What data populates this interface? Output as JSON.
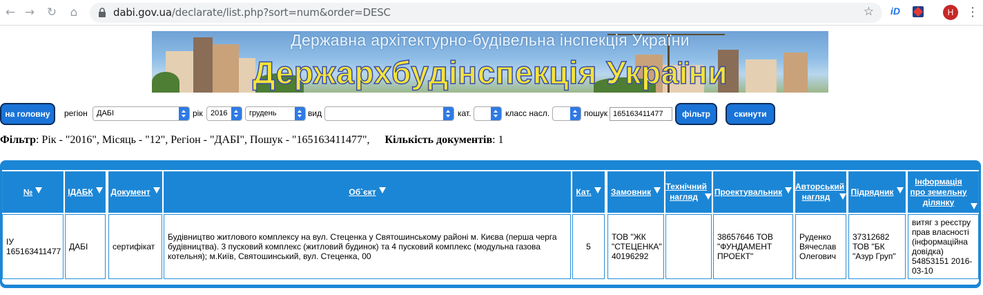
{
  "browser": {
    "url_host": "dabi.gov.ua",
    "url_path": "/declarate/list.php?sort=num&order=DESC",
    "ext_id_label": "iD",
    "avatar_letter": "Н"
  },
  "banner": {
    "top_text": "Державна архітектурно-будівельна інспекція України",
    "main_text": "Держархбудінспекція України"
  },
  "filter_bar": {
    "home_button": "на головну",
    "region_label": "регіон",
    "region_value": "ДАБІ",
    "year_label": "рік",
    "year_value": "2016",
    "month_value": "грудень",
    "type_label": "вид",
    "type_value": "",
    "cat_label": "кат.",
    "cat_value": "",
    "class_label": "класс насл.",
    "class_value": "",
    "search_label": "пошук",
    "search_value": "165163411477",
    "filter_button": "фільтр",
    "reset_button": "скинути"
  },
  "summary": {
    "filter_label": "Фільтр",
    "filter_text": ": Рік - \"2016\", Місяць - \"12\", Регіон - \"ДАБІ\", Пошук - \"165163411477\",",
    "count_label": "Кількість документів",
    "count_text": ": 1"
  },
  "table": {
    "headers": [
      "№",
      "ІДАБК",
      "Документ",
      "Об`єкт",
      "Кат.",
      "Замовник",
      "Технічний нагляд",
      "Проектувальник",
      "Авторський нагляд",
      "Підрядник",
      "Інформація про земельну ділянку"
    ],
    "rows": [
      {
        "num": "ІУ 165163411477",
        "idabk": "ДАБІ",
        "document": "сертифікат",
        "object": "Будівництво житлового комплексу на вул. Стеценка у Святошинському районі м. Києва (перша черга будівництва). 3 пусковий комплекс (житловий будинок) та 4 пусковий комплекс (модульна газова котельня); м.Київ, Святошинський, вул. Стеценка, 00",
        "category": "5",
        "customer": "ТОВ \"ЖК \"СТЕЦЕНКА\" 40196292",
        "tech_supervision": "",
        "designer": "38657646 ТОВ \"ФУНДАМЕНТ ПРОЕКТ\"",
        "author_supervision": "Руденко Вячеслав Олегович",
        "contractor": "37312682 ТОВ \"БК \"Азур Груп\"",
        "land_info": "витяг з реєстру прав власності (інформаційна довідка) 54853151 2016-03-10"
      }
    ]
  }
}
